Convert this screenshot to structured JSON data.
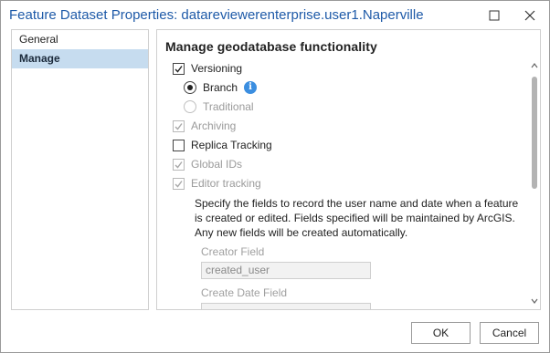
{
  "window": {
    "title": "Feature Dataset Properties: datareviewerenterprise.user1.Naperville"
  },
  "sidebar": {
    "items": [
      {
        "label": "General",
        "active": false
      },
      {
        "label": "Manage",
        "active": true
      }
    ]
  },
  "content": {
    "section_title": "Manage geodatabase functionality",
    "versioning": {
      "label": "Versioning",
      "checked": true,
      "enabled": true
    },
    "branch": {
      "label": "Branch",
      "selected": true,
      "enabled": true
    },
    "traditional": {
      "label": "Traditional",
      "selected": false,
      "enabled": false
    },
    "archiving": {
      "label": "Archiving",
      "checked": true,
      "enabled": false
    },
    "replica_tracking": {
      "label": "Replica Tracking",
      "checked": false,
      "enabled": true
    },
    "global_ids": {
      "label": "Global IDs",
      "checked": true,
      "enabled": false
    },
    "editor_tracking": {
      "label": "Editor tracking",
      "checked": true,
      "enabled": false
    },
    "description": "Specify the fields to record the user name and date when a feature is created or edited. Fields specified will be maintained by ArcGIS. Any new fields will be created automatically.",
    "creator_field": {
      "label": "Creator Field",
      "value": "created_user"
    },
    "create_date_field": {
      "label": "Create Date Field",
      "value": ""
    }
  },
  "footer": {
    "ok_label": "OK",
    "cancel_label": "Cancel"
  },
  "colors": {
    "title": "#1e5aa8",
    "selected_nav": "#c6dcef",
    "info_icon": "#3b8ee0"
  },
  "icons": [
    "minimize-icon",
    "close-icon",
    "info-icon",
    "checkmark-icon"
  ]
}
